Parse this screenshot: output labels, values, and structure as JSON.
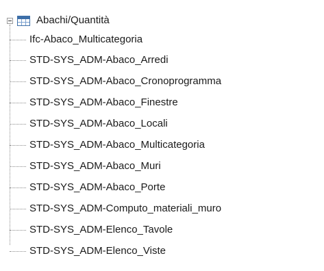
{
  "tree": {
    "root": {
      "label": "Abachi/Quantità",
      "expanded": true,
      "expander_icon": "minus-box-icon",
      "icon": "schedule-table-icon",
      "icon_color": "#3d6fa8"
    },
    "children": [
      {
        "label": "Ifc-Abaco_Multicategoria"
      },
      {
        "label": "STD-SYS_ADM-Abaco_Arredi"
      },
      {
        "label": "STD-SYS_ADM-Abaco_Cronoprogramma"
      },
      {
        "label": "STD-SYS_ADM-Abaco_Finestre"
      },
      {
        "label": "STD-SYS_ADM-Abaco_Locali"
      },
      {
        "label": "STD-SYS_ADM-Abaco_Multicategoria"
      },
      {
        "label": "STD-SYS_ADM-Abaco_Muri"
      },
      {
        "label": "STD-SYS_ADM-Abaco_Porte"
      },
      {
        "label": "STD-SYS_ADM-Computo_materiali_muro"
      },
      {
        "label": "STD-SYS_ADM-Elenco_Tavole"
      },
      {
        "label": "STD-SYS_ADM-Elenco_Viste"
      }
    ]
  }
}
